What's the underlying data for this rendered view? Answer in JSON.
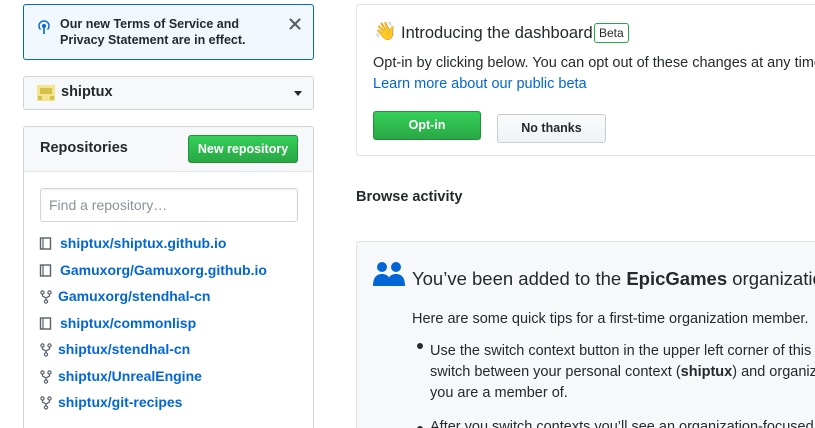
{
  "flash": {
    "message": "Our new Terms of Service and Privacy Statement are in effect."
  },
  "context_switcher": {
    "account": "shiptux"
  },
  "repositories": {
    "title": "Repositories",
    "new_button": "New repository",
    "find_placeholder": "Find a repository…",
    "items": [
      {
        "name": "shiptux/shiptux.github.io",
        "icon": "repo-icon"
      },
      {
        "name": "Gamuxorg/Gamuxorg.github.io",
        "icon": "repo-icon"
      },
      {
        "name": "Gamuxorg/stendhal-cn",
        "icon": "repo-forked-icon"
      },
      {
        "name": "shiptux/commonlisp",
        "icon": "repo-icon"
      },
      {
        "name": "shiptux/stendhal-cn",
        "icon": "repo-forked-icon"
      },
      {
        "name": "shiptux/UnrealEngine",
        "icon": "repo-forked-icon"
      },
      {
        "name": "shiptux/git-recipes",
        "icon": "repo-forked-icon"
      }
    ]
  },
  "intro": {
    "emoji": "👋",
    "title": "Introducing the dashboard",
    "badge": "Beta",
    "description": "Opt-in by clicking below. You can opt out of these changes at any time",
    "learn_more": "Learn more about our public beta",
    "optin_button": "Opt-in",
    "nothanks_button": "No thanks"
  },
  "browse_activity": "Browse activity",
  "org_notice": {
    "heading_prefix": "You’ve been added to the ",
    "org_name": "EpicGames",
    "heading_suffix": " organization",
    "tips": "Here are some quick tips for a first-time organization member.",
    "tip1_line1": "Use the switch context button in the upper left corner of this p",
    "tip1_line2_prefix": "switch between your personal context (",
    "tip1_line2_user": "shiptux",
    "tip1_line2_suffix": ") and organiza",
    "tip1_line3": "you are a member of.",
    "tip2": "After you switch contexts you’ll see an organization-focused d"
  },
  "colors": {
    "accent_blue": "#0366d6",
    "primary_green": "#2ea44f"
  }
}
